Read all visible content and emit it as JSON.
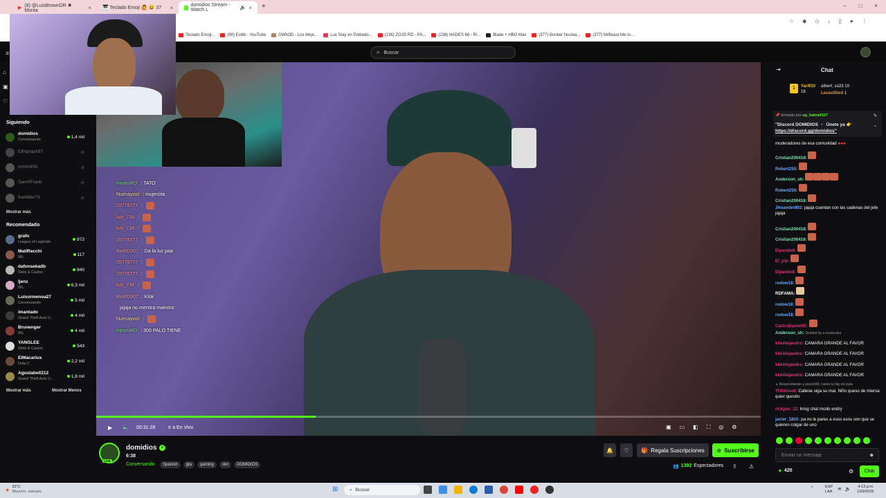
{
  "browser": {
    "tabs": [
      {
        "label": "(8) @LuisBrownDR ✖ Monta"
      },
      {
        "label": "🎹 Teclado Emoji 🙋 😃 37"
      },
      {
        "label": "domidios Stream - Watch L"
      }
    ],
    "bookmarks": [
      "Teclado Emoji...",
      "(90) Esttik - YouTube",
      "OWN3D - Los Mejo...",
      "Lux Stay en Poblado...",
      "(136) ZOJO RD - PA...",
      "(238) HADES 66 - Ri...",
      "Blade + HBO Max",
      "(377) Bunker Nuclea...",
      "(377) MrBeast Me In..."
    ]
  },
  "topbar": {
    "search_placeholder": "Buscar"
  },
  "sidebar": {
    "following_title": "Siguiendo",
    "following": [
      {
        "name": "domidios",
        "sub": "Conversando",
        "viewers": "1,4 mil",
        "live": true
      },
      {
        "name": "ElPandaX97",
        "live": false
      },
      {
        "name": "minimiRD",
        "live": false
      },
      {
        "name": "SamXFrank",
        "live": false
      },
      {
        "name": "frankllier73",
        "live": false
      }
    ],
    "show_more": "Mostrar más",
    "recommended_title": "Recomendado",
    "recommended": [
      {
        "name": "grafo",
        "sub": "League of Legends",
        "viewers": "972"
      },
      {
        "name": "MatiRecchi",
        "sub": "IRL",
        "viewers": "117"
      },
      {
        "name": "dafonsekadb",
        "sub": "Slots & Casino",
        "viewers": "940"
      },
      {
        "name": "ljenz",
        "sub": "IRL",
        "viewers": "6,3 mil"
      },
      {
        "name": "Luisormenoa27",
        "sub": "Conversando",
        "viewers": "5 mil"
      },
      {
        "name": "imantado",
        "sub": "Grand Theft Auto V...",
        "viewers": "4 mil"
      },
      {
        "name": "Brunenger",
        "sub": "IRL",
        "viewers": "4 mil"
      },
      {
        "name": "YANGLEE",
        "sub": "Slots & Casino",
        "viewers": "543"
      },
      {
        "name": "ElMacarius",
        "sub": "Dota 2",
        "viewers": "2,2 mil"
      },
      {
        "name": "Agustabell212",
        "sub": "Grand Theft Auto V...",
        "viewers": "1,8 mil"
      }
    ],
    "show_more_2": "Mostrar más",
    "show_less": "Mostrar Menos"
  },
  "overlay_chat": [
    {
      "user": "minimiRD",
      "text": ": TATO"
    },
    {
      "user": "Nuevayool",
      "text": ": mujercita"
    },
    {
      "user": "15776777",
      "text": ":"
    },
    {
      "user": "luis_734",
      "text": ":"
    },
    {
      "user": "luis_734",
      "text": ":"
    },
    {
      "user": "15776777",
      "text": ":"
    },
    {
      "user": "BioRD007",
      "text": ": Da la luz paa"
    },
    {
      "user": "15776777",
      "text": ":"
    },
    {
      "user": "15776777",
      "text": ":"
    },
    {
      "user": "luis_734",
      "text": ":"
    },
    {
      "user": "BioRD007",
      "text": ": Klok"
    },
    {
      "user": "",
      "text": "jajaja no mentira maestro"
    },
    {
      "user": "Nuevayool",
      "text": ":"
    },
    {
      "user": "minimiRD",
      "text": ": 300 PALO TIENE"
    }
  ],
  "player": {
    "time": "00:31:28",
    "live_label": "Ir a En Vivo",
    "progress": 0.33
  },
  "channel": {
    "name": "domidios",
    "avatar_badge": "6:38",
    "category": "Conversando",
    "tags": [
      "Spanish",
      "gta",
      "gaming",
      "slot",
      "DOMIDIOS"
    ],
    "gift_label": "Regala Suscripciones",
    "subscribe_label": "Suscribirse",
    "viewers": "1392",
    "viewers_label": "Espectadores"
  },
  "chat": {
    "title": "Chat",
    "top_gifters": [
      {
        "name": "Yari910",
        "count": "18"
      },
      {
        "name": "albert_sz23",
        "count": "10"
      },
      {
        "name": "Lesscliford",
        "count": "1"
      }
    ],
    "pinned_by": "Enviado por",
    "pinned_user": "og_kabra0127",
    "pinned_text": "\"Discord DOMIDIOS 🔹 Únete ya 👉",
    "pinned_link": "https://discord.gg/domidios\"",
    "messages": [
      {
        "user": "",
        "text": "moderadores de esa comunidad",
        "color": "#fff"
      },
      {
        "user": "Cristian200418:",
        "text": "",
        "color": "#7fe0b0"
      },
      {
        "user": "Robert255:",
        "text": "",
        "color": "#6aa5ff"
      },
      {
        "user": "Anderson_sh:",
        "text": "",
        "color": "#7fe0b0"
      },
      {
        "user": "Robert255:",
        "text": "",
        "color": "#6aa5ff"
      },
      {
        "user": "Cristian200418:",
        "text": "",
        "color": "#7fe0b0"
      },
      {
        "user": "Jhoander892:",
        "text": "jajaja cuentan con las cadenas del jefe jajaja",
        "color": "#6aa5ff"
      },
      {
        "user": "Cristian200418:",
        "text": "",
        "color": "#7fe0b0"
      },
      {
        "user": "Cristian200418:",
        "text": "",
        "color": "#7fe0b0"
      },
      {
        "user": "Elpando8:",
        "text": "",
        "color": "#e0337a"
      },
      {
        "user": "El_pip:",
        "text": "",
        "color": "#e0337a"
      },
      {
        "user": "Elpando8:",
        "text": "",
        "color": "#e0337a"
      },
      {
        "user": "rodow18:",
        "text": "",
        "color": "#6aa5ff"
      },
      {
        "user": "RDFAMA:",
        "text": "",
        "color": "#fff"
      },
      {
        "user": "rodow18:",
        "text": "",
        "color": "#6aa5ff"
      },
      {
        "user": "rodow18:",
        "text": "",
        "color": "#6aa5ff"
      },
      {
        "user": "CarlosDaniel05:",
        "text": "",
        "color": "#e0337a"
      },
      {
        "user": "Anderson_sh:",
        "text": "Deleted by a moderator",
        "color": "#7fe0b0"
      },
      {
        "user": "kkkAlejandro:",
        "text": "CAMARA GRANDE AL FAVOR",
        "color": "#e0337a"
      },
      {
        "user": "kkkAlejandro:",
        "text": "CAMARA GRANDE AL FAVOR",
        "color": "#e0337a"
      },
      {
        "user": "kkkAlejandro:",
        "text": "CAMARA GRANDE AL FAVOR",
        "color": "#e0337a"
      },
      {
        "user": "kkkAlejandro:",
        "text": "CAMARA GRANDE AL FAVOR",
        "color": "#e0337a"
      }
    ],
    "reply_note": "Respondiendo a josez048: rueda tu hijo de puta",
    "more_messages": [
      {
        "user": "Tt3hbioo8:",
        "text": "Callese siga su mai. Niño queso de miersa quier quesito",
        "color": "#e0337a"
      },
      {
        "user": "rickyao_12:",
        "text": "lmsg chat modo endry",
        "color": "#e0337a"
      },
      {
        "user": "javier_1802:",
        "text": "pa no le pares a esos esos son que se quieren colgar de uno",
        "color": "#6aa5ff"
      }
    ],
    "input_placeholder": "Enviar un mensaje",
    "points": "420",
    "send_label": "Chat"
  },
  "taskbar": {
    "weather_temp": "33°C",
    "weather_desc": "Mayorm. soleado",
    "search_placeholder": "Buscar",
    "lang1": "ESP",
    "lang2": "LAA",
    "time": "4:13 p.m.",
    "date": "13/9/2025"
  }
}
